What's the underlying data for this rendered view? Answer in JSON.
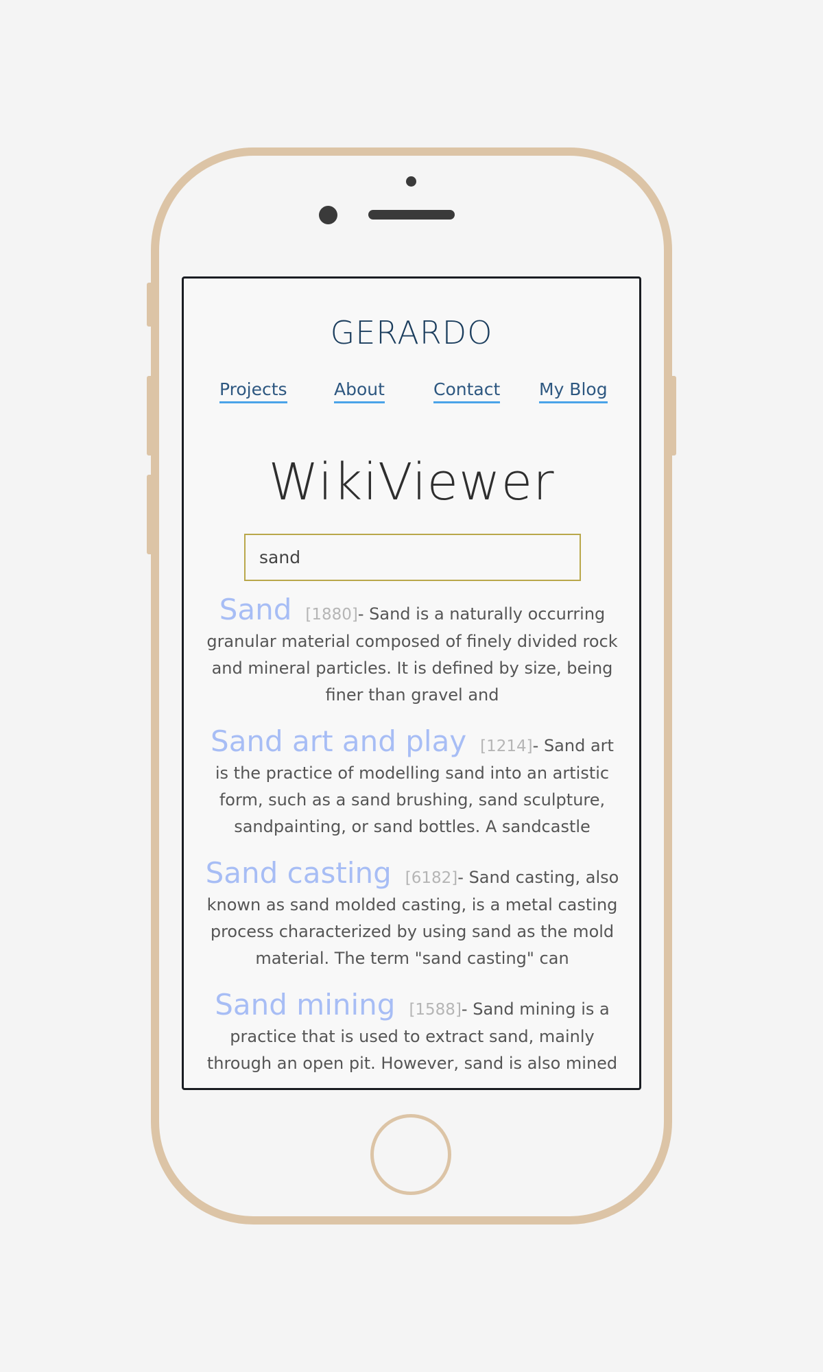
{
  "site": {
    "title": "GERARDO"
  },
  "nav": {
    "items": [
      {
        "label": "Projects"
      },
      {
        "label": "About"
      },
      {
        "label": "Contact"
      },
      {
        "label": "My Blog"
      }
    ]
  },
  "app": {
    "title": "WikiViewer"
  },
  "search": {
    "value": "sand"
  },
  "results": [
    {
      "title": "Sand",
      "count": "[1880]",
      "snippet": "- Sand is a naturally occurring granular material composed of finely divided rock and mineral particles. It is defined by size, being finer than gravel and"
    },
    {
      "title": "Sand art and play",
      "count": "[1214]",
      "snippet": "- Sand art is the practice of modelling sand into an artistic form, such as a sand brushing, sand sculpture, sandpainting, or sand bottles. A sandcastle"
    },
    {
      "title": "Sand casting",
      "count": "[6182]",
      "snippet": "- Sand casting, also known as sand molded casting, is a metal casting process characterized by using sand as the mold material. The term \"sand casting\" can"
    },
    {
      "title": "Sand mining",
      "count": "[1588]",
      "snippet": "- Sand mining is a practice that is used to extract sand, mainly through an open pit. However, sand is also mined"
    }
  ],
  "colors": {
    "phone_frame": "#dcc4a6",
    "site_title": "#1b3d5d",
    "nav_link": "#2d5780",
    "nav_underline": "#4aa3e8",
    "result_title": "#a7bdf5",
    "search_border": "#b9a74a"
  }
}
